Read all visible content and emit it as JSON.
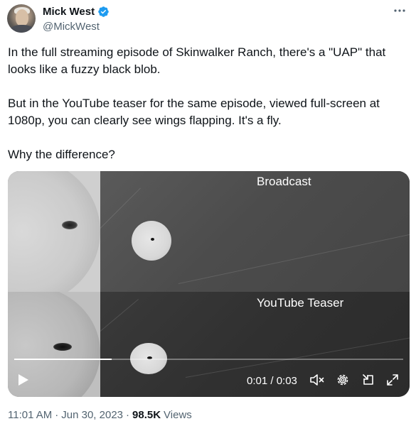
{
  "author": {
    "display_name": "Mick West",
    "handle": "@MickWest",
    "verified": true
  },
  "tweet": {
    "paragraphs": [
      "In the full streaming episode of Skinwalker Ranch, there's a \"UAP\" that looks like a fuzzy black blob.",
      "But in the YouTube teaser for the same episode, viewed full-screen at 1080p, you can clearly see wings flapping. It's a fly.",
      "Why the difference?"
    ]
  },
  "media": {
    "top_label": "Broadcast",
    "bottom_label": "YouTube Teaser",
    "timecode": "0:01 / 0:03",
    "progress_fraction": 0.25
  },
  "footer": {
    "time": "11:01 AM",
    "separator": "·",
    "date": "Jun 30, 2023",
    "views_count": "98.5K",
    "views_label": "Views"
  },
  "colors": {
    "verified_badge": "#1d9bf0",
    "text_primary": "#0f1419",
    "text_secondary": "#536471"
  },
  "icons": {
    "more": "more-horizontal-icon",
    "play": "play-icon",
    "mute": "volume-muted-icon",
    "settings": "gear-icon",
    "dock": "picture-in-picture-icon",
    "fullscreen": "expand-icon"
  }
}
